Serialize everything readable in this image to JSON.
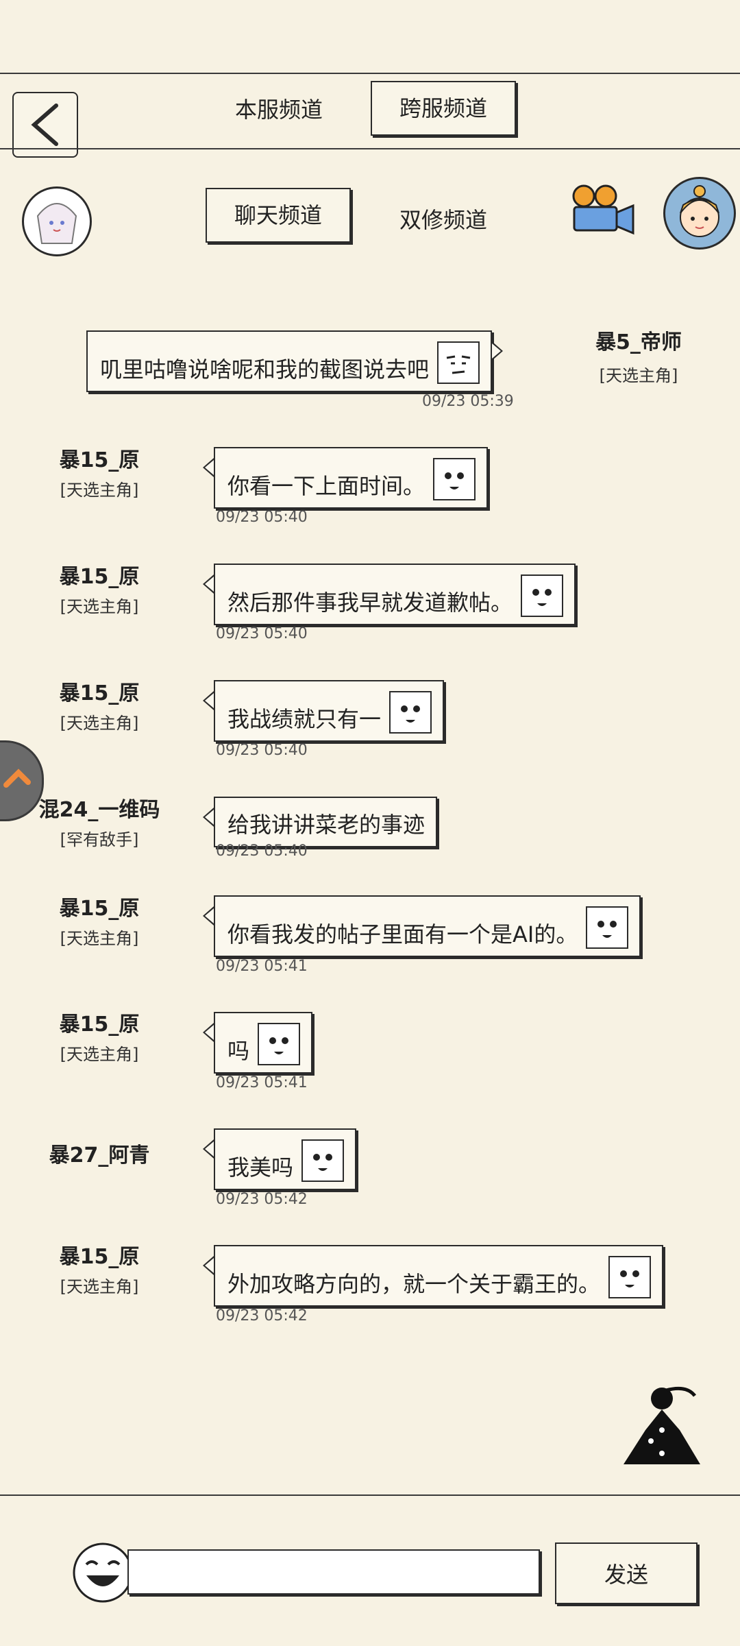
{
  "server_tabs": {
    "local": "本服频道",
    "cross": "跨服频道"
  },
  "channel_tabs": {
    "chat": "聊天频道",
    "dual": "双修频道"
  },
  "messages": [
    {
      "name": "暴5_帝师",
      "title": "[天选主角]",
      "text": "叽里咕噜说啥呢和我的截图说去吧",
      "time": "09/23 05:39",
      "side": "right"
    },
    {
      "name": "暴15_原",
      "title": "[天选主角]",
      "text": "你看一下上面时间。",
      "time": "09/23 05:40"
    },
    {
      "name": "暴15_原",
      "title": "[天选主角]",
      "text": "然后那件事我早就发道歉帖。",
      "time": "09/23 05:40"
    },
    {
      "name": "暴15_原",
      "title": "[天选主角]",
      "text": "我战绩就只有一",
      "time": "09/23 05:40"
    },
    {
      "name": "混24_一维码",
      "title": "[罕有敌手]",
      "text": "给我讲讲菜老的事迹",
      "time": "09/23 05:40"
    },
    {
      "name": "暴15_原",
      "title": "[天选主角]",
      "text": "你看我发的帖子里面有一个是AI的。",
      "time": "09/23 05:41"
    },
    {
      "name": "暴15_原",
      "title": "[天选主角]",
      "text": "吗",
      "time": "09/23 05:41"
    },
    {
      "name": "暴27_阿青",
      "title": "",
      "text": "我美吗",
      "time": "09/23 05:42"
    },
    {
      "name": "暴15_原",
      "title": "[天选主角]",
      "text": "外加攻略方向的，就一个关于霸王的。",
      "time": "09/23 05:42"
    }
  ],
  "input": {
    "placeholder": "",
    "value": ""
  },
  "send_label": "发送",
  "icons": {
    "back": "back-arrow-icon",
    "avatar": "anime-girl-avatar",
    "camera": "movie-camera-icon",
    "support": "customer-service-avatar",
    "float": "floating-assist-icon",
    "meditate": "meditating-figure-icon",
    "emoji": "laughing-face-icon"
  }
}
